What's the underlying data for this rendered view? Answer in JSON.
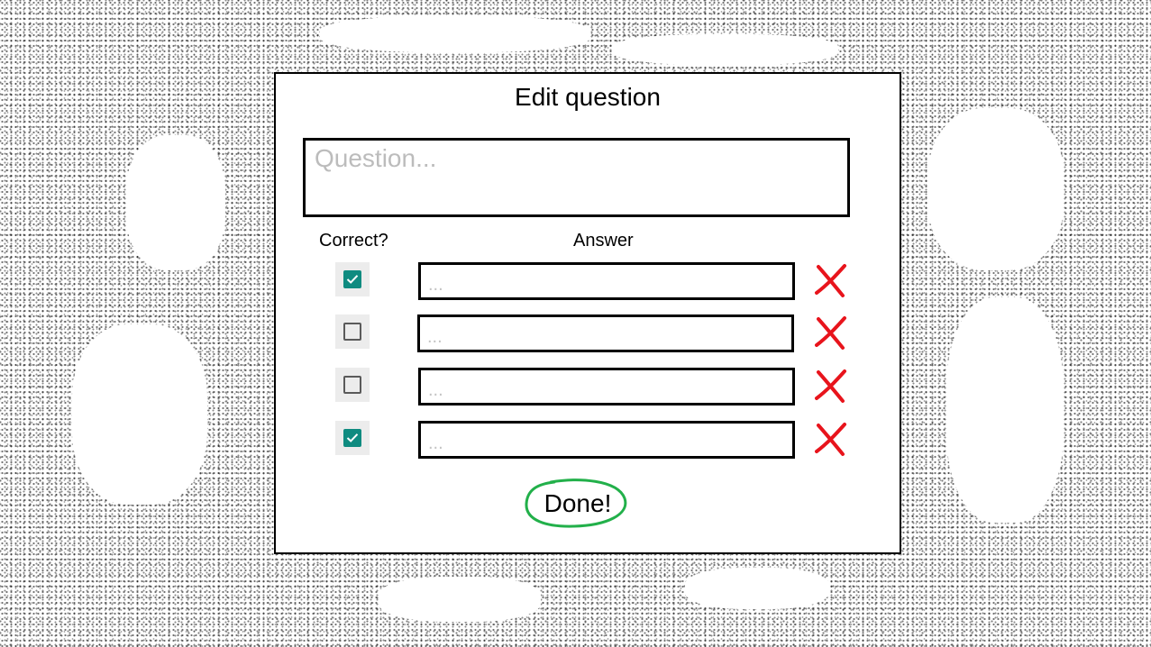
{
  "dialog": {
    "title": "Edit question",
    "question_placeholder": "Question...",
    "question_value": "",
    "headers": {
      "correct": "Correct?",
      "answer": "Answer"
    },
    "answers": [
      {
        "correct": true,
        "placeholder": "...",
        "value": ""
      },
      {
        "correct": false,
        "placeholder": "...",
        "value": ""
      },
      {
        "correct": false,
        "placeholder": "...",
        "value": ""
      },
      {
        "correct": true,
        "placeholder": "...",
        "value": ""
      }
    ],
    "done_label": "Done!",
    "icons": {
      "checkbox": "checkmark-icon",
      "delete": "red-x-icon",
      "done_outline": "green-circle-outline"
    }
  },
  "colors": {
    "checkbox_checked": "#0f8b80",
    "delete_icon": "#e8141c",
    "done_outline": "#22b04a",
    "placeholder": "#bcbcbc"
  }
}
